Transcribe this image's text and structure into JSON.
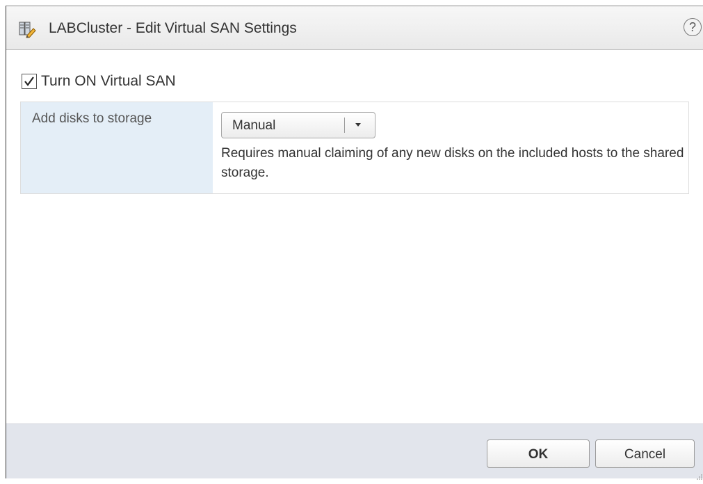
{
  "dialog": {
    "title": "LABCluster - Edit Virtual SAN Settings",
    "title_icon": "cluster-edit-icon",
    "help_label": "?"
  },
  "vsan": {
    "enabled": true,
    "enable_label": "Turn ON Virtual SAN"
  },
  "settings": {
    "add_disks_label": "Add disks to storage",
    "mode_selected": "Manual",
    "mode_description": "Requires manual claiming of any new disks on the included hosts to the shared storage."
  },
  "footer": {
    "ok_label": "OK",
    "cancel_label": "Cancel"
  }
}
